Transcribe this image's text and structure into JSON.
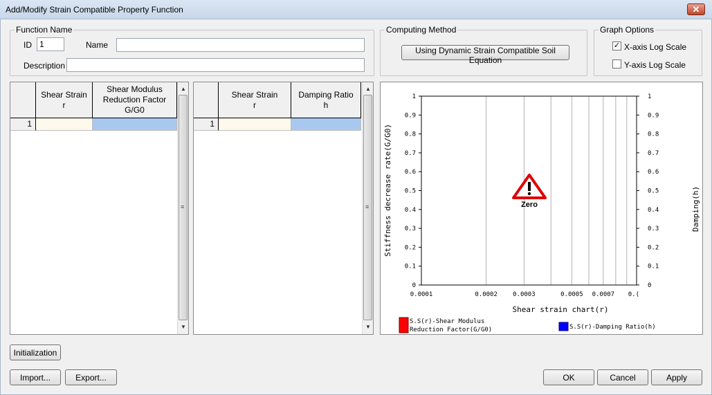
{
  "window": {
    "title": "Add/Modify Strain Compatible Property Function",
    "close_glyph": "✕"
  },
  "function_name": {
    "legend": "Function Name",
    "id_label": "ID",
    "id_value": "1",
    "name_label": "Name",
    "name_value": "",
    "description_label": "Description",
    "description_value": ""
  },
  "computing_method": {
    "legend": "Computing Method",
    "button_label": "Using Dynamic Strain Compatible Soil Equation"
  },
  "graph_options": {
    "legend": "Graph Options",
    "x_log_label": "X-axis Log Scale",
    "x_log_checked": true,
    "y_log_label": "Y-axis Log Scale",
    "y_log_checked": false,
    "check_glyph": "✓"
  },
  "left_table": {
    "col1_line1": "Shear Strain",
    "col1_line2": "r",
    "col2_line1": "Shear Modulus",
    "col2_line2": "Reduction Factor",
    "col2_line3": "G/G0",
    "rows": [
      {
        "index": "1",
        "c1": "",
        "c2": ""
      }
    ]
  },
  "right_table": {
    "col1_line1": "Shear Strain",
    "col1_line2": "r",
    "col2_line1": "Damping Ratio",
    "col2_line2": "h",
    "rows": [
      {
        "index": "1",
        "c1": "",
        "c2": ""
      }
    ]
  },
  "scroll": {
    "up": "▲",
    "down": "▼",
    "grip": "≡"
  },
  "chart_data": {
    "type": "line",
    "xlabel": "Shear strain chart(r)",
    "ylabel_left": "Stiffness decrease rate(G/G0)",
    "ylabel_right": "Damping(h)",
    "x_scale": "log",
    "x_ticks": [
      "0.0001",
      "0.0002",
      "0.0003",
      "0.0005",
      "0.0007",
      "0.("
    ],
    "y_ticks": [
      "0",
      "0.1",
      "0.2",
      "0.3",
      "0.4",
      "0.5",
      "0.6",
      "0.7",
      "0.8",
      "0.9",
      "1"
    ],
    "ylim": [
      0,
      1
    ],
    "warning_text": "Zero",
    "legend": [
      {
        "line1": "S.S(r)-Shear Modulus",
        "line2": "Reduction Factor(G/G0)",
        "color": "#ff0000"
      },
      {
        "line1": "S.S(r)-Damping Ratio(h)",
        "line2": "",
        "color": "#0000ff"
      }
    ],
    "series": []
  },
  "buttons": {
    "initialization": "Initialization",
    "import": "Import...",
    "export": "Export...",
    "ok": "OK",
    "cancel": "Cancel",
    "apply": "Apply"
  }
}
